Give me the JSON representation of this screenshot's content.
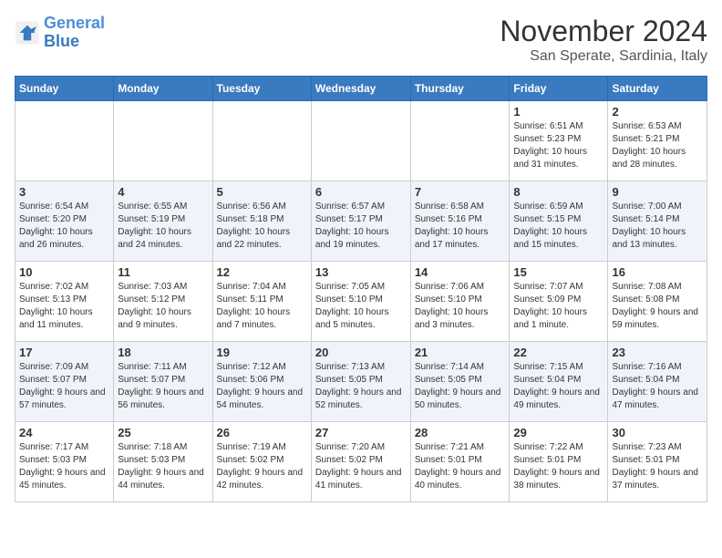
{
  "logo": {
    "text_general": "General",
    "text_blue": "Blue"
  },
  "header": {
    "month": "November 2024",
    "location": "San Sperate, Sardinia, Italy"
  },
  "weekdays": [
    "Sunday",
    "Monday",
    "Tuesday",
    "Wednesday",
    "Thursday",
    "Friday",
    "Saturday"
  ],
  "weeks": [
    [
      {
        "day": "",
        "info": ""
      },
      {
        "day": "",
        "info": ""
      },
      {
        "day": "",
        "info": ""
      },
      {
        "day": "",
        "info": ""
      },
      {
        "day": "",
        "info": ""
      },
      {
        "day": "1",
        "info": "Sunrise: 6:51 AM\nSunset: 5:23 PM\nDaylight: 10 hours and 31 minutes."
      },
      {
        "day": "2",
        "info": "Sunrise: 6:53 AM\nSunset: 5:21 PM\nDaylight: 10 hours and 28 minutes."
      }
    ],
    [
      {
        "day": "3",
        "info": "Sunrise: 6:54 AM\nSunset: 5:20 PM\nDaylight: 10 hours and 26 minutes."
      },
      {
        "day": "4",
        "info": "Sunrise: 6:55 AM\nSunset: 5:19 PM\nDaylight: 10 hours and 24 minutes."
      },
      {
        "day": "5",
        "info": "Sunrise: 6:56 AM\nSunset: 5:18 PM\nDaylight: 10 hours and 22 minutes."
      },
      {
        "day": "6",
        "info": "Sunrise: 6:57 AM\nSunset: 5:17 PM\nDaylight: 10 hours and 19 minutes."
      },
      {
        "day": "7",
        "info": "Sunrise: 6:58 AM\nSunset: 5:16 PM\nDaylight: 10 hours and 17 minutes."
      },
      {
        "day": "8",
        "info": "Sunrise: 6:59 AM\nSunset: 5:15 PM\nDaylight: 10 hours and 15 minutes."
      },
      {
        "day": "9",
        "info": "Sunrise: 7:00 AM\nSunset: 5:14 PM\nDaylight: 10 hours and 13 minutes."
      }
    ],
    [
      {
        "day": "10",
        "info": "Sunrise: 7:02 AM\nSunset: 5:13 PM\nDaylight: 10 hours and 11 minutes."
      },
      {
        "day": "11",
        "info": "Sunrise: 7:03 AM\nSunset: 5:12 PM\nDaylight: 10 hours and 9 minutes."
      },
      {
        "day": "12",
        "info": "Sunrise: 7:04 AM\nSunset: 5:11 PM\nDaylight: 10 hours and 7 minutes."
      },
      {
        "day": "13",
        "info": "Sunrise: 7:05 AM\nSunset: 5:10 PM\nDaylight: 10 hours and 5 minutes."
      },
      {
        "day": "14",
        "info": "Sunrise: 7:06 AM\nSunset: 5:10 PM\nDaylight: 10 hours and 3 minutes."
      },
      {
        "day": "15",
        "info": "Sunrise: 7:07 AM\nSunset: 5:09 PM\nDaylight: 10 hours and 1 minute."
      },
      {
        "day": "16",
        "info": "Sunrise: 7:08 AM\nSunset: 5:08 PM\nDaylight: 9 hours and 59 minutes."
      }
    ],
    [
      {
        "day": "17",
        "info": "Sunrise: 7:09 AM\nSunset: 5:07 PM\nDaylight: 9 hours and 57 minutes."
      },
      {
        "day": "18",
        "info": "Sunrise: 7:11 AM\nSunset: 5:07 PM\nDaylight: 9 hours and 56 minutes."
      },
      {
        "day": "19",
        "info": "Sunrise: 7:12 AM\nSunset: 5:06 PM\nDaylight: 9 hours and 54 minutes."
      },
      {
        "day": "20",
        "info": "Sunrise: 7:13 AM\nSunset: 5:05 PM\nDaylight: 9 hours and 52 minutes."
      },
      {
        "day": "21",
        "info": "Sunrise: 7:14 AM\nSunset: 5:05 PM\nDaylight: 9 hours and 50 minutes."
      },
      {
        "day": "22",
        "info": "Sunrise: 7:15 AM\nSunset: 5:04 PM\nDaylight: 9 hours and 49 minutes."
      },
      {
        "day": "23",
        "info": "Sunrise: 7:16 AM\nSunset: 5:04 PM\nDaylight: 9 hours and 47 minutes."
      }
    ],
    [
      {
        "day": "24",
        "info": "Sunrise: 7:17 AM\nSunset: 5:03 PM\nDaylight: 9 hours and 45 minutes."
      },
      {
        "day": "25",
        "info": "Sunrise: 7:18 AM\nSunset: 5:03 PM\nDaylight: 9 hours and 44 minutes."
      },
      {
        "day": "26",
        "info": "Sunrise: 7:19 AM\nSunset: 5:02 PM\nDaylight: 9 hours and 42 minutes."
      },
      {
        "day": "27",
        "info": "Sunrise: 7:20 AM\nSunset: 5:02 PM\nDaylight: 9 hours and 41 minutes."
      },
      {
        "day": "28",
        "info": "Sunrise: 7:21 AM\nSunset: 5:01 PM\nDaylight: 9 hours and 40 minutes."
      },
      {
        "day": "29",
        "info": "Sunrise: 7:22 AM\nSunset: 5:01 PM\nDaylight: 9 hours and 38 minutes."
      },
      {
        "day": "30",
        "info": "Sunrise: 7:23 AM\nSunset: 5:01 PM\nDaylight: 9 hours and 37 minutes."
      }
    ]
  ]
}
